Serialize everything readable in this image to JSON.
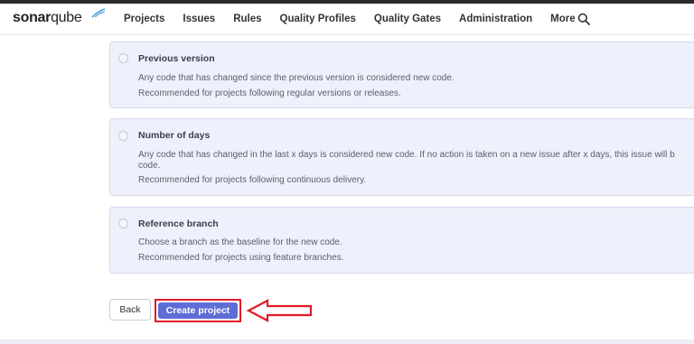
{
  "brand": {
    "logo_bold": "sonar",
    "logo_light": "qube"
  },
  "nav": {
    "items": [
      {
        "label": "Projects"
      },
      {
        "label": "Issues"
      },
      {
        "label": "Rules"
      },
      {
        "label": "Quality Profiles"
      },
      {
        "label": "Quality Gates"
      },
      {
        "label": "Administration"
      },
      {
        "label": "More"
      }
    ],
    "search_icon": "search-icon"
  },
  "options": [
    {
      "title": "Previous version",
      "lines": [
        "Any code that has changed since the previous version is considered new code.",
        "Recommended for projects following regular versions or releases."
      ]
    },
    {
      "title": "Number of days",
      "lines": [
        "Any code that has changed in the last x days is considered new code. If no action is taken on a new issue after x days, this issue will b",
        "code.",
        "Recommended for projects following continuous delivery."
      ]
    },
    {
      "title": "Reference branch",
      "lines": [
        "Choose a branch as the baseline for the new code.",
        "Recommended for projects using feature branches."
      ]
    }
  ],
  "actions": {
    "back_label": "Back",
    "create_label": "Create project"
  },
  "colors": {
    "primary": "#5e6cd5",
    "highlight": "#e01b24",
    "card_bg": "#eef1fb"
  }
}
